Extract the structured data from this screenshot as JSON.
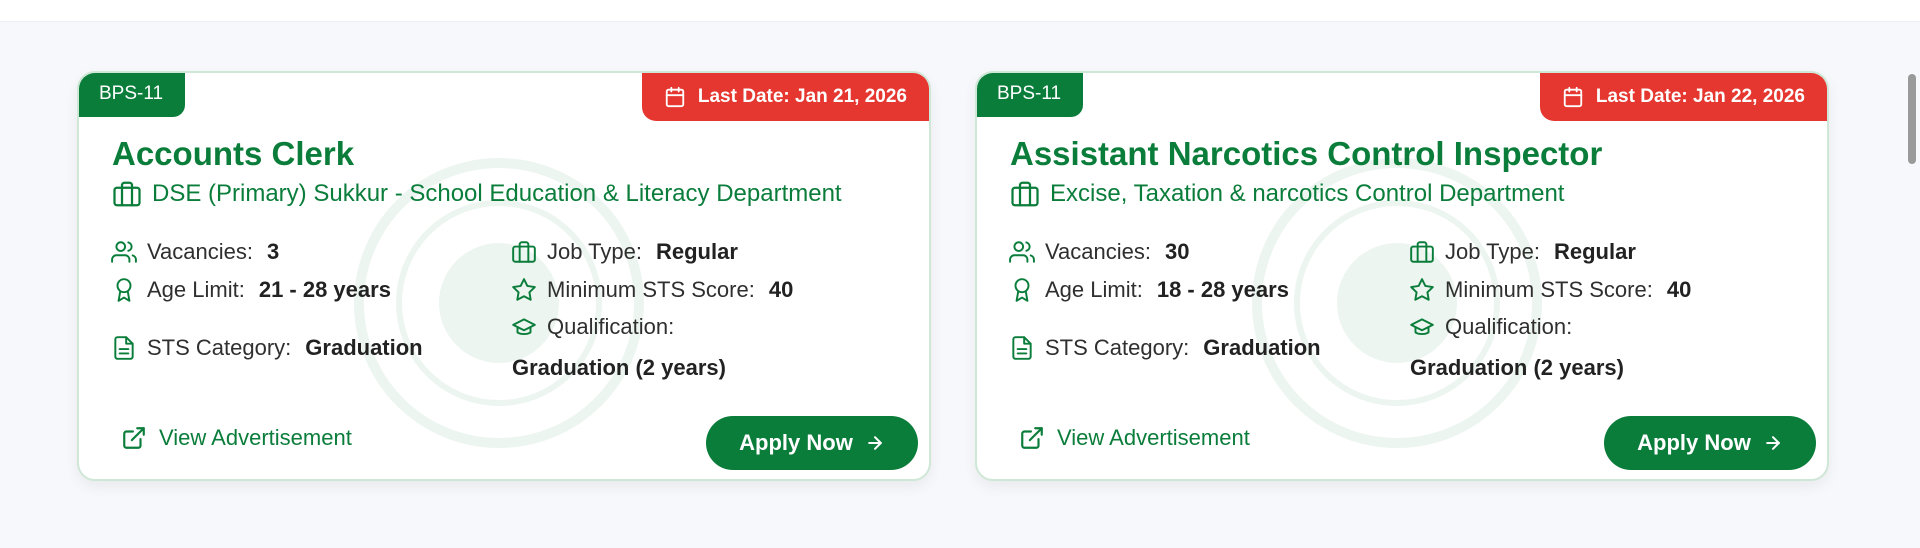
{
  "colors": {
    "brand_green": "#0b7d3b",
    "deadline_red": "#e5372f",
    "card_border": "#cfe7d6"
  },
  "cards": [
    {
      "bps": "BPS-11",
      "last_date": "Last Date: Jan 21, 2026",
      "title": "Accounts Clerk",
      "department": "DSE (Primary) Sukkur - School Education & Literacy Department",
      "vacancies_label": "Vacancies:",
      "vacancies": "3",
      "age_label": "Age Limit:",
      "age": "21 - 28 years",
      "sts_category_label": "STS Category:",
      "sts_category": "Graduation",
      "job_type_label": "Job Type:",
      "job_type": "Regular",
      "min_sts_label": "Minimum STS Score:",
      "min_sts": "40",
      "qualification_label": "Qualification:",
      "qualification": "Graduation (2 years)",
      "view_ad_label": "View Advertisement",
      "apply_label": "Apply Now"
    },
    {
      "bps": "BPS-11",
      "last_date": "Last Date: Jan 22, 2026",
      "title": "Assistant Narcotics Control Inspector",
      "department": "Excise, Taxation & narcotics Control Department",
      "vacancies_label": "Vacancies:",
      "vacancies": "30",
      "age_label": "Age Limit:",
      "age": "18 - 28 years",
      "sts_category_label": "STS Category:",
      "sts_category": "Graduation",
      "job_type_label": "Job Type:",
      "job_type": "Regular",
      "min_sts_label": "Minimum STS Score:",
      "min_sts": "40",
      "qualification_label": "Qualification:",
      "qualification": "Graduation (2 years)",
      "view_ad_label": "View Advertisement",
      "apply_label": "Apply Now"
    }
  ],
  "icons": {
    "deadline": "calendar-icon",
    "department": "briefcase-icon",
    "vacancies": "users-icon",
    "age": "award-icon",
    "sts_category": "document-icon",
    "job_type": "briefcase-icon",
    "min_sts": "star-icon",
    "qualification": "graduation-cap-icon",
    "view_ad": "external-link-icon",
    "apply": "arrow-right-icon"
  }
}
